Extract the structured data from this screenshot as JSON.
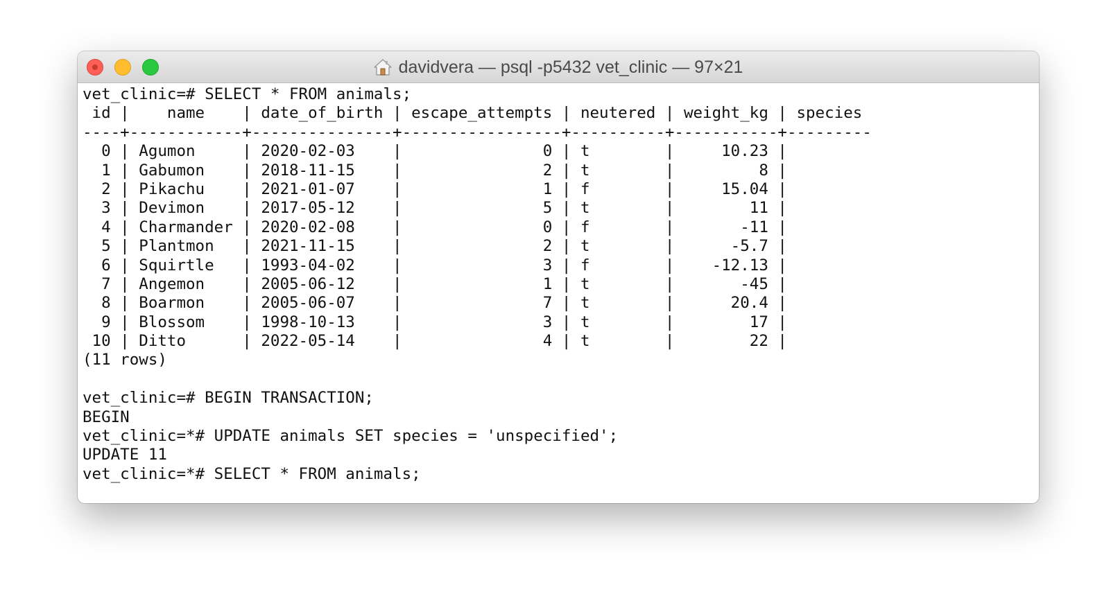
{
  "window": {
    "title": "davidvera — psql -p5432 vet_clinic — 97×21",
    "title_icon": "home-icon"
  },
  "terminal": {
    "lines": [
      "vet_clinic=# SELECT * FROM animals;",
      " id |    name    | date_of_birth | escape_attempts | neutered | weight_kg | species",
      "----+------------+---------------+-----------------+----------+-----------+---------",
      "  0 | Agumon     | 2020-02-03    |               0 | t        |     10.23 |",
      "  1 | Gabumon    | 2018-11-15    |               2 | t        |         8 |",
      "  2 | Pikachu    | 2021-01-07    |               1 | f        |     15.04 |",
      "  3 | Devimon    | 2017-05-12    |               5 | t        |        11 |",
      "  4 | Charmander | 2020-02-08    |               0 | f        |       -11 |",
      "  5 | Plantmon   | 2021-11-15    |               2 | t        |      -5.7 |",
      "  6 | Squirtle   | 1993-04-02    |               3 | f        |    -12.13 |",
      "  7 | Angemon    | 2005-06-12    |               1 | t        |       -45 |",
      "  8 | Boarmon    | 2005-06-07    |               7 | t        |      20.4 |",
      "  9 | Blossom    | 1998-10-13    |               3 | t        |        17 |",
      " 10 | Ditto      | 2022-05-14    |               4 | t        |        22 |",
      "(11 rows)",
      "",
      "vet_clinic=# BEGIN TRANSACTION;",
      "BEGIN",
      "vet_clinic=*# UPDATE animals SET species = 'unspecified';",
      "UPDATE 11",
      "vet_clinic=*# SELECT * FROM animals;"
    ]
  }
}
